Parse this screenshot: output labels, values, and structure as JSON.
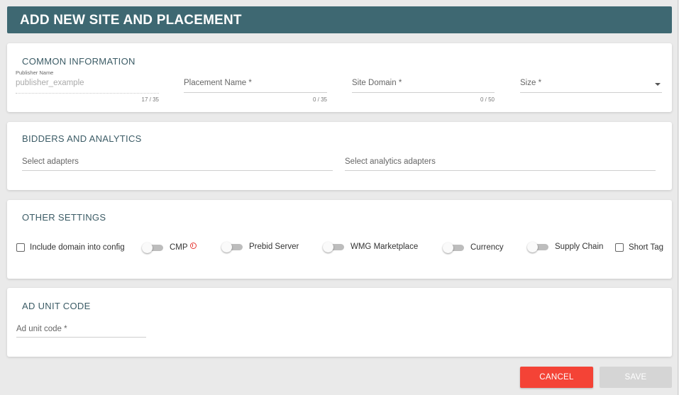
{
  "header": {
    "title": "ADD NEW SITE AND PLACEMENT"
  },
  "common": {
    "title": "COMMON INFORMATION",
    "publisher": {
      "label": "Publisher Name",
      "value": "publisher_example",
      "counter": "17 / 35"
    },
    "placement": {
      "label": "Placement Name *",
      "counter": "0 / 35"
    },
    "site_domain": {
      "label": "Site Domain *",
      "counter": "0 / 50"
    },
    "size": {
      "label": "Size *"
    }
  },
  "bidders": {
    "title": "BIDDERS AND ANALYTICS",
    "adapters": "Select adapters",
    "analytics": "Select analytics adapters"
  },
  "other": {
    "title": "OTHER SETTINGS",
    "include_domain": "Include domain into config",
    "cmp": "CMP",
    "prebid_server": "Prebid Server",
    "wmg_marketplace": "WMG Marketplace",
    "currency": "Currency",
    "supply_chain": "Supply Chain",
    "short_tag": "Short Tag"
  },
  "adunit": {
    "title": "AD UNIT CODE",
    "label": "Ad unit code *"
  },
  "buttons": {
    "cancel": "CANCEL",
    "save": "SAVE"
  },
  "colors": {
    "header": "#3e6872",
    "cancel": "#f44336",
    "save_disabled": "#d5d5d5",
    "info": "#e53935"
  },
  "icons": {
    "dropdown": "caret-down-icon",
    "info": "info-icon"
  }
}
